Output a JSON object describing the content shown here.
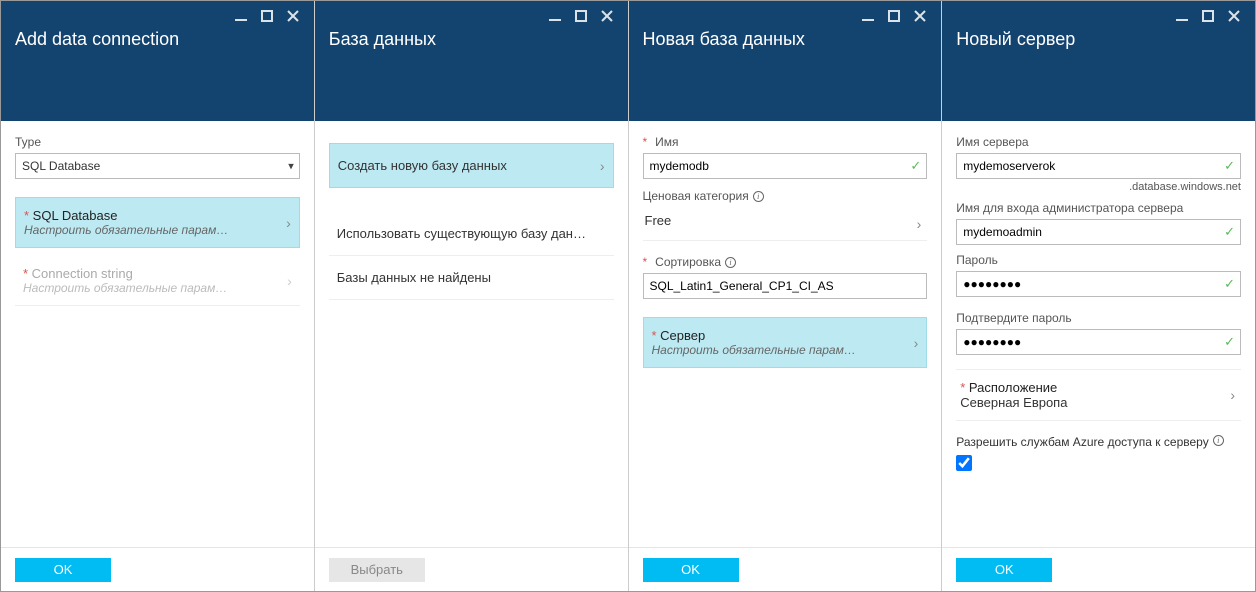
{
  "blade1": {
    "title": "Add data connection",
    "type_label": "Type",
    "type_value": "SQL Database",
    "sql_title": "SQL Database",
    "sql_sub": "Настроить обязательные парам…",
    "conn_title": "Connection string",
    "conn_sub": "Настроить обязательные парам…",
    "ok": "OK"
  },
  "blade2": {
    "title": "База данных",
    "create_new": "Создать новую базу данных",
    "use_existing": "Использовать существующую базу дан…",
    "not_found": "Базы данных не найдены",
    "select_btn": "Выбрать"
  },
  "blade3": {
    "title": "Новая база данных",
    "name_label": "Имя",
    "name_value": "mydemodb",
    "price_label": "Ценовая категория",
    "price_value": "Free",
    "coll_label": "Сортировка",
    "coll_value": "SQL_Latin1_General_CP1_CI_AS",
    "server_title": "Сервер",
    "server_sub": "Настроить обязательные парам…",
    "ok": "OK"
  },
  "blade4": {
    "title": "Новый сервер",
    "srvname_label": "Имя сервера",
    "srvname_value": "mydemoserverok",
    "srv_suffix": ".database.windows.net",
    "login_label": "Имя для входа администратора сервера",
    "login_value": "mydemoadmin",
    "pwd_label": "Пароль",
    "pwd_value": "●●●●●●●●",
    "pwd2_label": "Подтвердите пароль",
    "pwd2_value": "●●●●●●●●",
    "loc_label": "Расположение",
    "loc_value": "Северная Европа",
    "allow_label": "Разрешить службам Azure доступа к серверу",
    "ok": "OK"
  }
}
